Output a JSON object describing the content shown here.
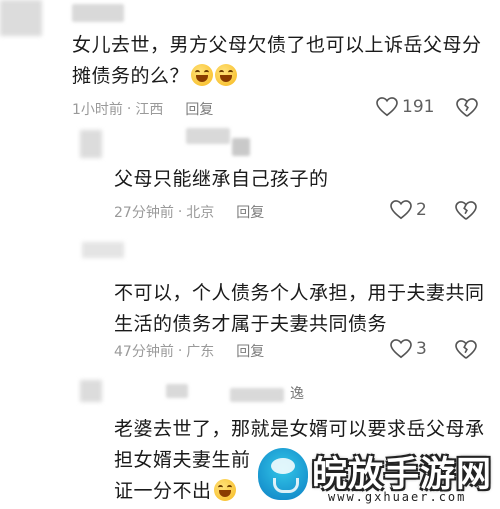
{
  "comments": [
    {
      "text_lines": [
        "女儿去世，男方父母欠债了也可以上诉岳父母分",
        "摊债务的么？"
      ],
      "emoji_count": 2,
      "time": "1小时前",
      "location": "江西",
      "reply": "回复",
      "likes": "191"
    },
    {
      "text_lines": [
        "父母只能继承自己孩子的"
      ],
      "time": "27分钟前",
      "location": "北京",
      "reply": "回复",
      "likes": "2"
    },
    {
      "text_lines": [
        "不可以，个人债务个人承担，用于夫妻共同",
        "生活的债务才属于夫妻共同债务"
      ],
      "time": "47分钟前",
      "location": "广东",
      "reply": "回复",
      "likes": "3"
    },
    {
      "username_fragment": "逸",
      "text_lines": [
        "老婆去世了，那就是女婿可以要求岳父母承",
        "担女婿夫妻生前",
        "证一分不出"
      ],
      "emoji": "rolling-laughing"
    }
  ],
  "watermark": {
    "title": "皖放手游网",
    "url": "www.gxhuaer.com"
  }
}
